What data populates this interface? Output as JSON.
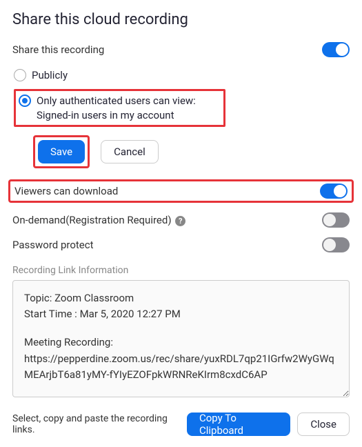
{
  "dialog": {
    "title": "Share this cloud recording"
  },
  "share": {
    "label": "Share this recording",
    "enabled": true,
    "options": {
      "publicly": "Publicly",
      "authenticated_line1": "Only authenticated users can view:",
      "authenticated_line2": "Signed-in users in my account"
    },
    "selected": "authenticated"
  },
  "buttons": {
    "save": "Save",
    "cancel": "Cancel",
    "copy": "Copy To Clipboard",
    "close": "Close"
  },
  "settings": {
    "viewers_download": {
      "label": "Viewers can download",
      "enabled": true
    },
    "on_demand": {
      "label": "On-demand(Registration Required)",
      "enabled": false
    },
    "password_protect": {
      "label": "Password protect",
      "enabled": false
    }
  },
  "link_info": {
    "section_label": "Recording Link Information",
    "topic_label": "Topic:",
    "topic_value": "Zoom Classroom",
    "start_label": "Start Time :",
    "start_value": "Mar 5, 2020 12:27 PM",
    "recording_label": "Meeting Recording:",
    "recording_url": "https://pepperdine.zoom.us/rec/share/yuxRDL7qp21IGrfw2WyGWqMEArjbT6a81yMY-fYIyEZOFpkWRNReKIrm8cxdC6AP"
  },
  "footer": {
    "hint": "Select, copy and paste the recording links."
  }
}
